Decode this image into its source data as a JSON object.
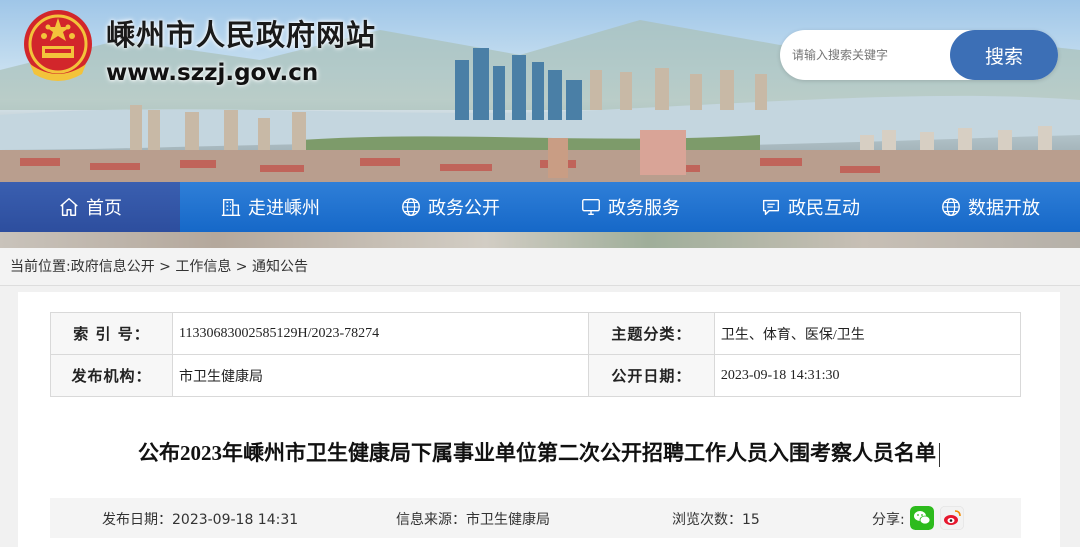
{
  "header": {
    "site_title": "嵊州市人民政府网站",
    "site_url": "www.szzj.gov.cn"
  },
  "search": {
    "placeholder": "请输入搜索关键字",
    "button_label": "搜索"
  },
  "nav": {
    "items": [
      {
        "label": "首页",
        "icon": "home-icon"
      },
      {
        "label": "走进嵊州",
        "icon": "building-icon"
      },
      {
        "label": "政务公开",
        "icon": "globe-icon"
      },
      {
        "label": "政务服务",
        "icon": "monitor-icon"
      },
      {
        "label": "政民互动",
        "icon": "chat-icon"
      },
      {
        "label": "数据开放",
        "icon": "globe-icon"
      }
    ],
    "active_index": 0
  },
  "breadcrumb": {
    "prefix": "当前位置:",
    "items": [
      "政府信息公开",
      "工作信息",
      "通知公告"
    ],
    "separator": " > "
  },
  "meta": {
    "index_label": "索 引 号：",
    "index_value": "11330683002585129H/2023-78274",
    "topic_label": "主题分类：",
    "topic_value": "卫生、体育、医保/卫生",
    "org_label": "发布机构：",
    "org_value": "市卫生健康局",
    "date_label": "公开日期：",
    "date_value": "2023-09-18 14:31:30"
  },
  "article": {
    "title": "公布2023年嵊州市卫生健康局下属事业单位第二次公开招聘工作人员入围考察人员名单"
  },
  "info": {
    "publish_date": "发布日期：2023-09-18 14:31",
    "source": "信息来源：市卫生健康局",
    "views": "浏览次数：15",
    "share_label": "分享:"
  },
  "colors": {
    "nav_blue": "#1f72d0",
    "nav_active": "#3358a8",
    "search_button": "#3c6fb6",
    "wechat_green": "#2dbb1d",
    "weibo_red": "#e6162d"
  }
}
